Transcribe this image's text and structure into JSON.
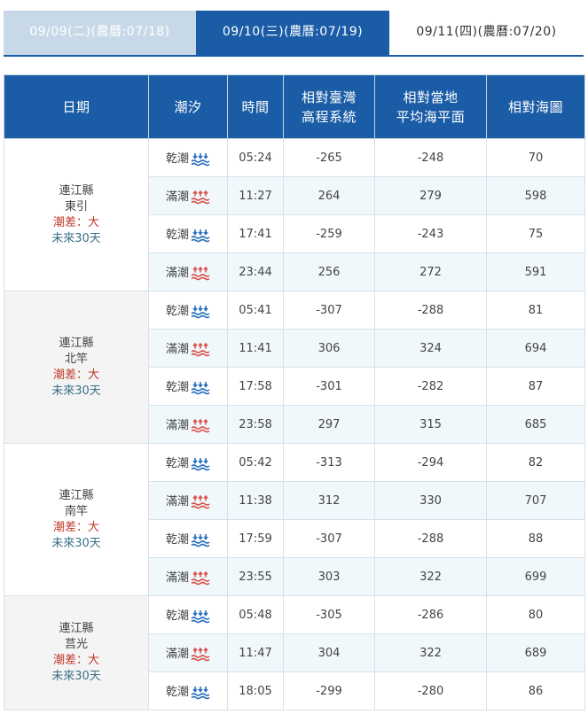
{
  "tabs": [
    {
      "label": "09/09(二)(農曆:07/18)"
    },
    {
      "label": "09/10(三)(農曆:07/19)"
    },
    {
      "label": "09/11(四)(農曆:07/20)"
    }
  ],
  "header": {
    "date": "日期",
    "tide": "潮汐",
    "time": "時間",
    "taiwan_line1": "相對臺灣",
    "taiwan_line2": "高程系統",
    "local_line1": "相對當地",
    "local_line2": "平均海平面",
    "chart": "相對海圖"
  },
  "colors": {
    "header_bg": "#1a5da6",
    "low_icon": "#2a6fbf",
    "high_icon": "#d9534f",
    "tide_diff": "#c0392b",
    "future": "#3a6f86"
  },
  "locations": [
    {
      "county": "連江縣",
      "station": "東引",
      "diff": "潮差：大",
      "future": "未來30天",
      "rows": [
        {
          "type": "乾潮",
          "kind": "low",
          "time": "05:24",
          "twvd": "-265",
          "msl": "-248",
          "chart": "70"
        },
        {
          "type": "滿潮",
          "kind": "high",
          "time": "11:27",
          "twvd": "264",
          "msl": "279",
          "chart": "598"
        },
        {
          "type": "乾潮",
          "kind": "low",
          "time": "17:41",
          "twvd": "-259",
          "msl": "-243",
          "chart": "75"
        },
        {
          "type": "滿潮",
          "kind": "high",
          "time": "23:44",
          "twvd": "256",
          "msl": "272",
          "chart": "591"
        }
      ]
    },
    {
      "county": "連江縣",
      "station": "北竿",
      "diff": "潮差：大",
      "future": "未來30天",
      "rows": [
        {
          "type": "乾潮",
          "kind": "low",
          "time": "05:41",
          "twvd": "-307",
          "msl": "-288",
          "chart": "81"
        },
        {
          "type": "滿潮",
          "kind": "high",
          "time": "11:41",
          "twvd": "306",
          "msl": "324",
          "chart": "694"
        },
        {
          "type": "乾潮",
          "kind": "low",
          "time": "17:58",
          "twvd": "-301",
          "msl": "-282",
          "chart": "87"
        },
        {
          "type": "滿潮",
          "kind": "high",
          "time": "23:58",
          "twvd": "297",
          "msl": "315",
          "chart": "685"
        }
      ]
    },
    {
      "county": "連江縣",
      "station": "南竿",
      "diff": "潮差：大",
      "future": "未來30天",
      "rows": [
        {
          "type": "乾潮",
          "kind": "low",
          "time": "05:42",
          "twvd": "-313",
          "msl": "-294",
          "chart": "82"
        },
        {
          "type": "滿潮",
          "kind": "high",
          "time": "11:38",
          "twvd": "312",
          "msl": "330",
          "chart": "707"
        },
        {
          "type": "乾潮",
          "kind": "low",
          "time": "17:59",
          "twvd": "-307",
          "msl": "-288",
          "chart": "88"
        },
        {
          "type": "滿潮",
          "kind": "high",
          "time": "23:55",
          "twvd": "303",
          "msl": "322",
          "chart": "699"
        }
      ]
    },
    {
      "county": "連江縣",
      "station": "莒光",
      "diff": "潮差：大",
      "future": "未來30天",
      "rows": [
        {
          "type": "乾潮",
          "kind": "low",
          "time": "05:48",
          "twvd": "-305",
          "msl": "-286",
          "chart": "80"
        },
        {
          "type": "滿潮",
          "kind": "high",
          "time": "11:47",
          "twvd": "304",
          "msl": "322",
          "chart": "689"
        },
        {
          "type": "乾潮",
          "kind": "low",
          "time": "18:05",
          "twvd": "-299",
          "msl": "-280",
          "chart": "86"
        }
      ]
    }
  ]
}
